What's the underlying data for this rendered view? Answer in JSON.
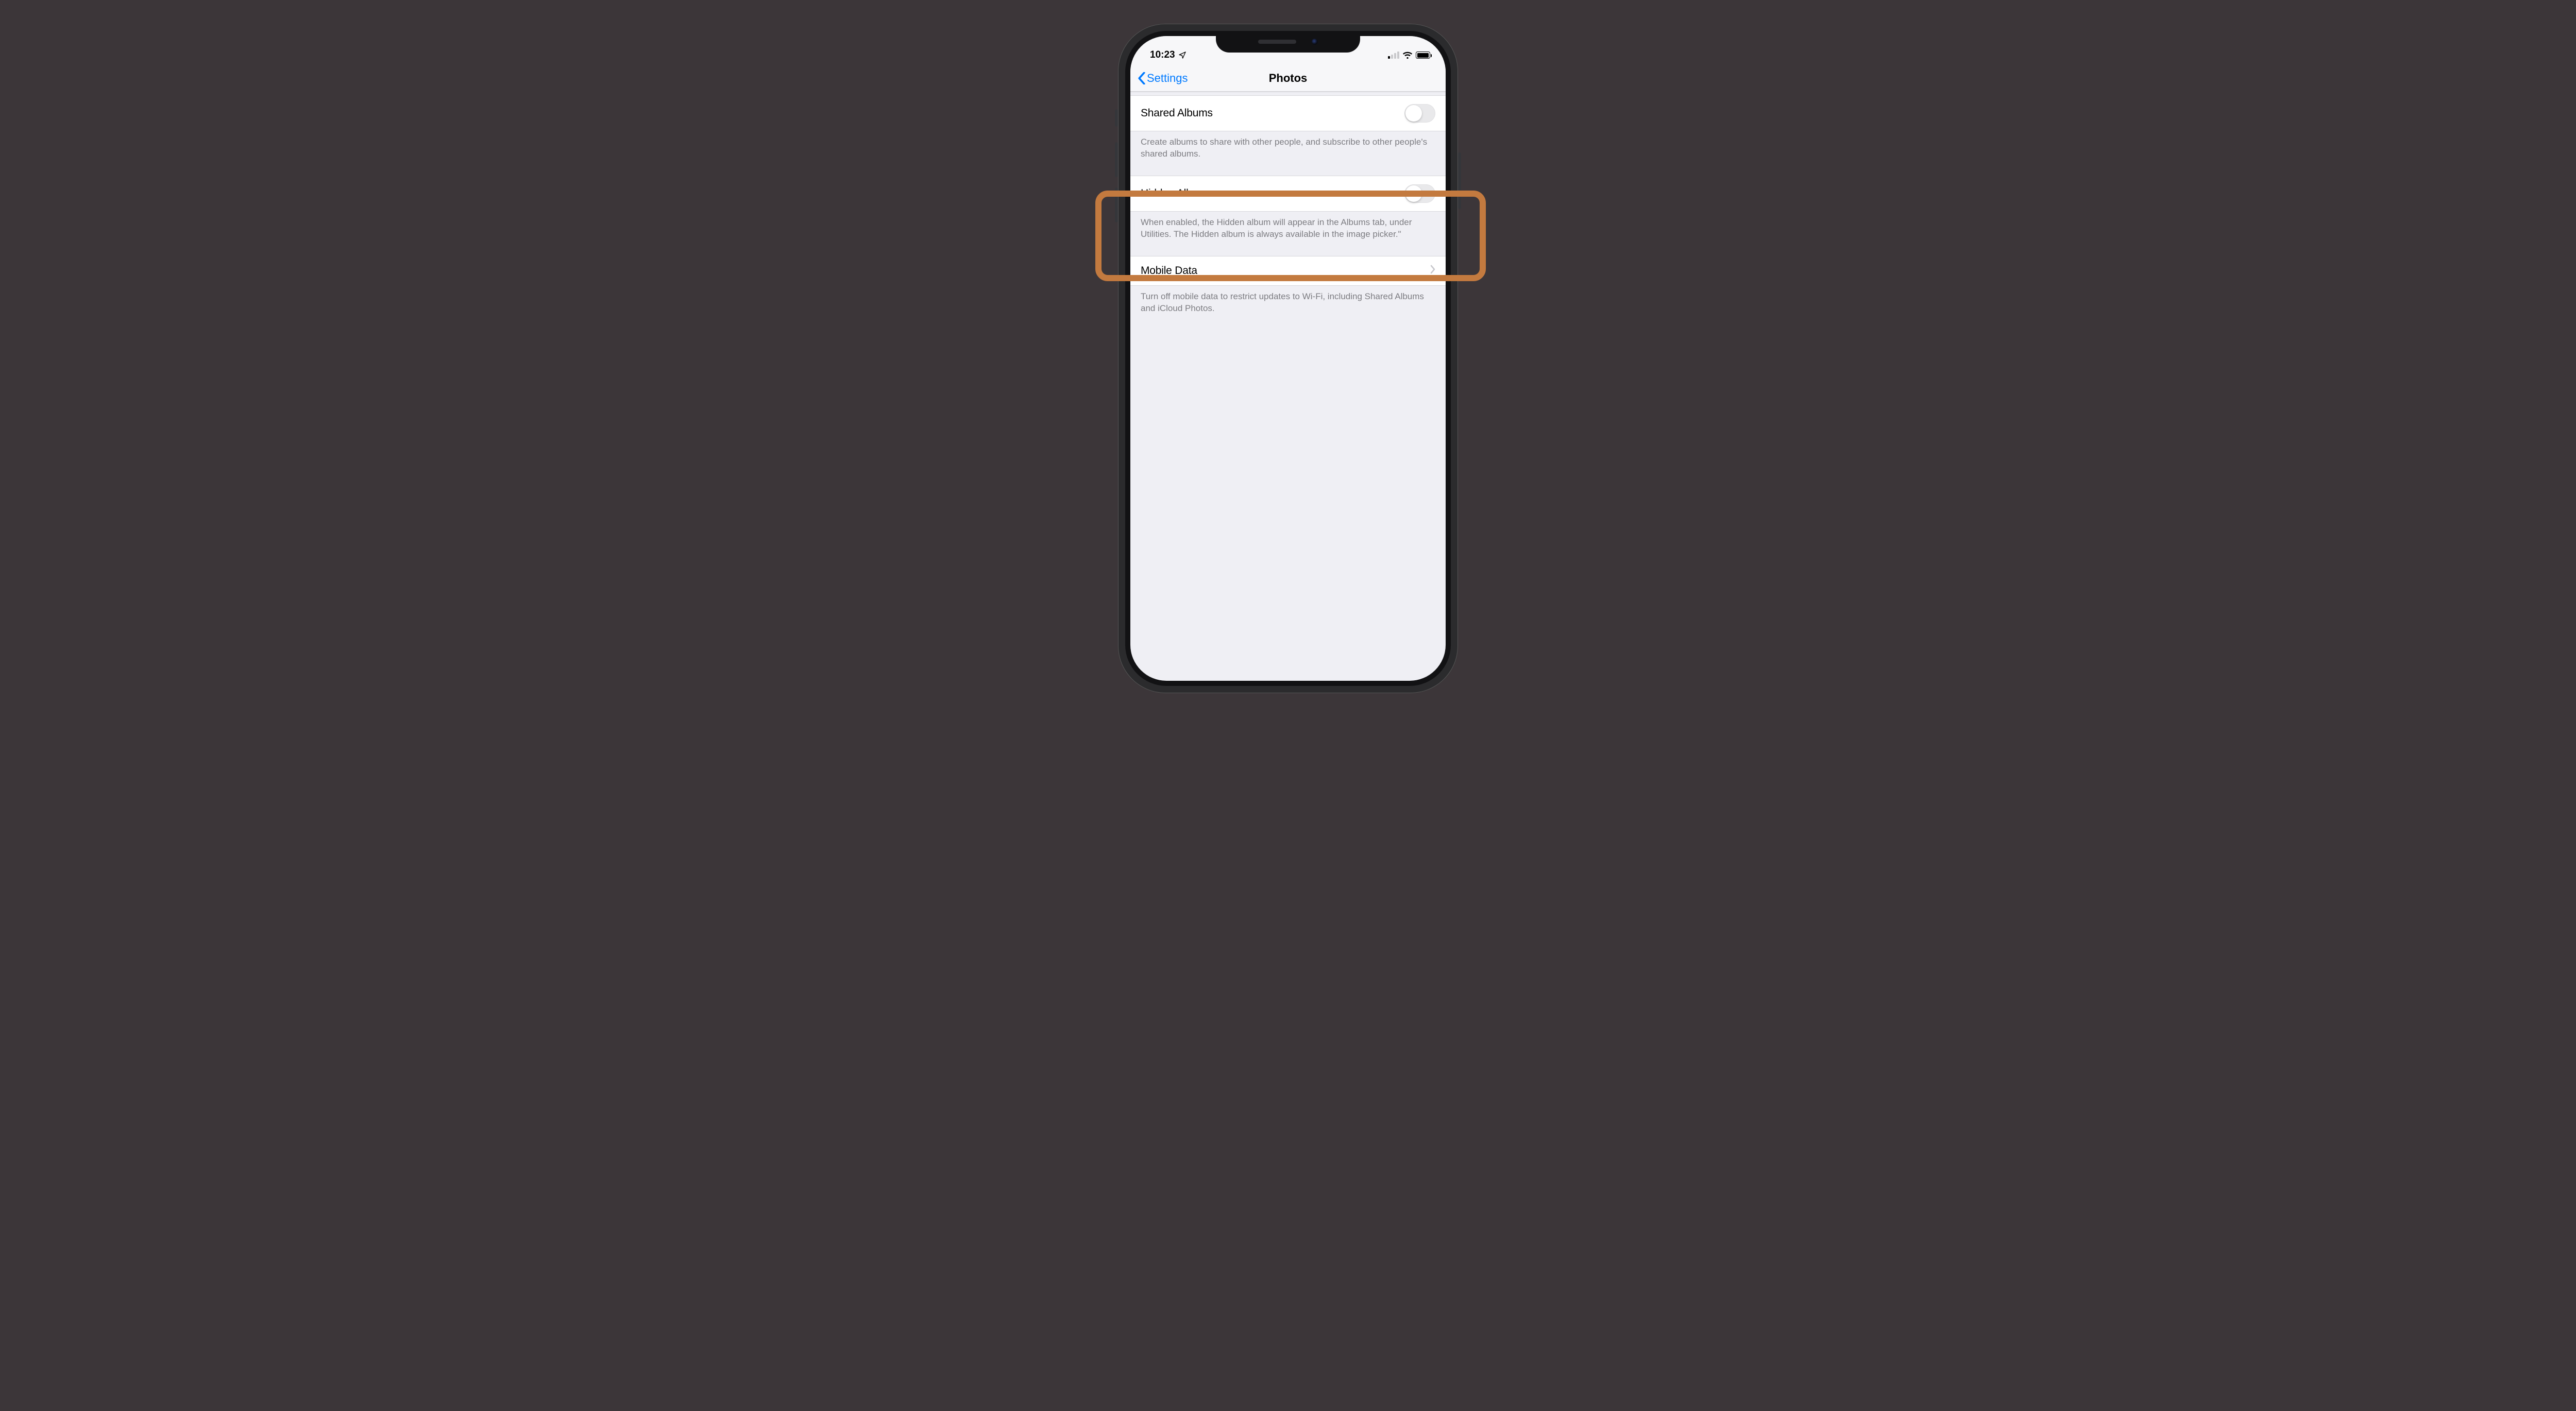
{
  "statusbar": {
    "time": "10:23",
    "location_icon": "location-arrow",
    "signal_bars_active": 1,
    "wifi_icon": "wifi",
    "battery_icon": "battery-full"
  },
  "nav": {
    "back_label": "Settings",
    "title": "Photos"
  },
  "groups": [
    {
      "row": {
        "label": "Shared Albums",
        "type": "toggle",
        "on": false
      },
      "footer": "Create albums to share with other people, and subscribe to other people's shared albums."
    },
    {
      "row": {
        "label": "Hidden Album",
        "type": "toggle",
        "on": false
      },
      "footer": "When enabled, the Hidden album will appear in the Albums tab, under Utilities. The Hidden album is always available in the image picker.\""
    },
    {
      "row": {
        "label": "Mobile Data",
        "type": "disclosure"
      },
      "footer": "Turn off mobile data to restrict updates to Wi-Fi, including Shared Albums and iCloud Photos."
    }
  ],
  "highlight_target": "hidden-album"
}
